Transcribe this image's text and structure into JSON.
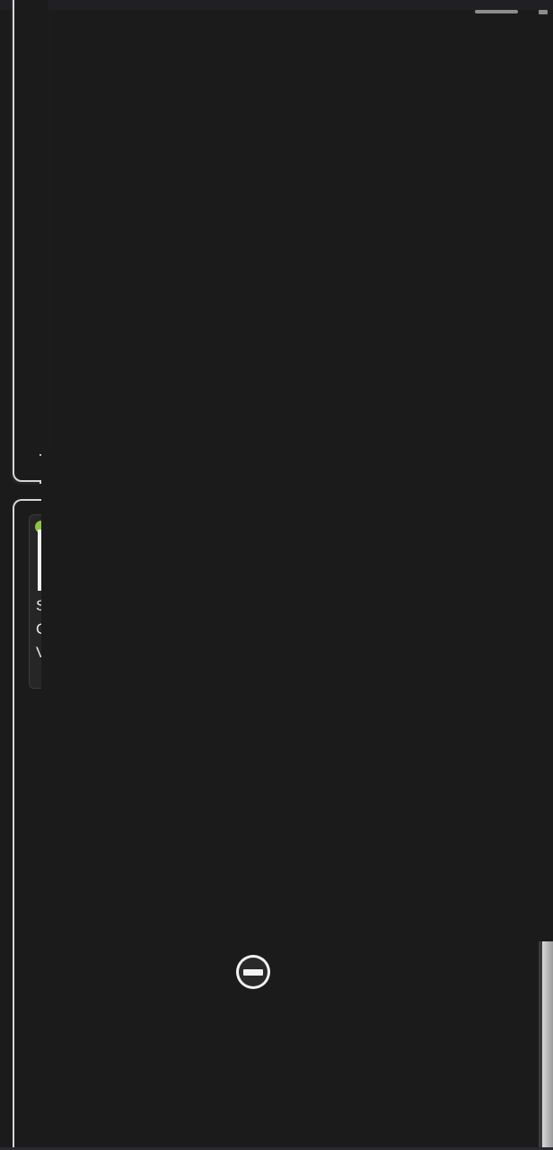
{
  "window": {
    "background_color": "#1b1b1b",
    "accent_color": "#8cc63f"
  },
  "card": {
    "line1": "S",
    "line2": "C",
    "line3": "V"
  },
  "remove_button": {
    "icon": "remove-circle-icon"
  }
}
